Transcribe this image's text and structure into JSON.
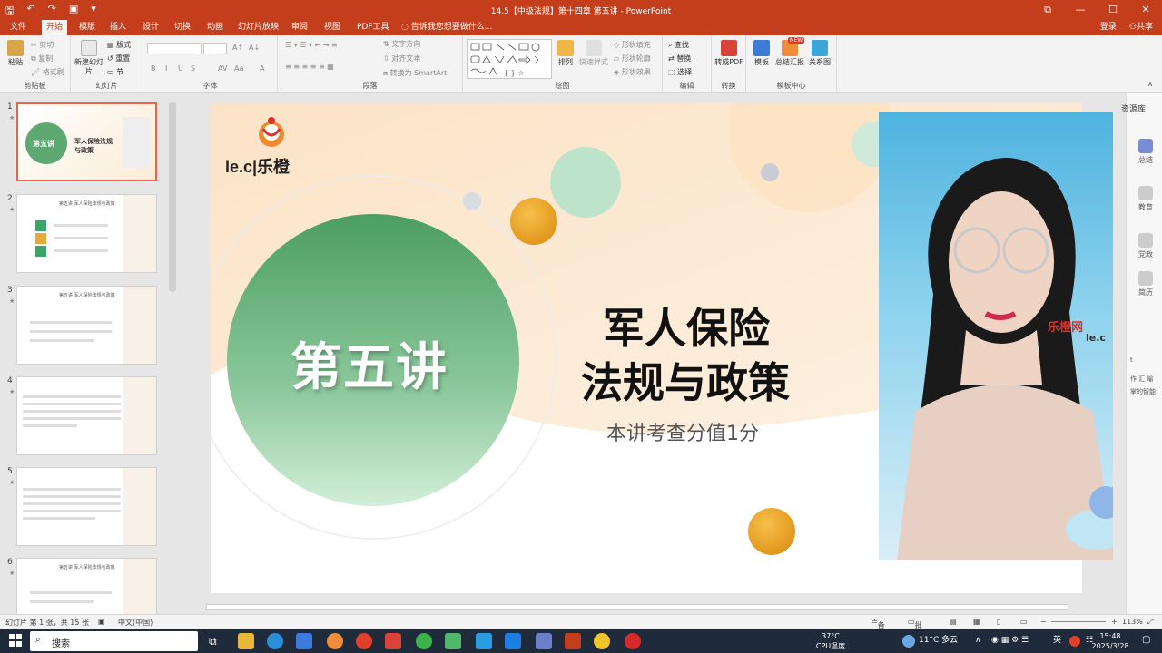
{
  "window": {
    "title": "14.5【中级法规】第十四章 第五讲 - PowerPoint",
    "controls": [
      "⧉",
      "—",
      "☐",
      "✕"
    ]
  },
  "tabs": {
    "items": [
      "文件",
      "开始",
      "模版",
      "插入",
      "设计",
      "切换",
      "动画",
      "幻灯片放映",
      "审阅",
      "视图",
      "PDF工具"
    ],
    "active_index": 1,
    "tell_me": "告诉我您想要做什么...",
    "login": "登录",
    "share": "共享"
  },
  "ribbon": {
    "clipboard": {
      "label": "剪贴板",
      "paste": "粘贴",
      "cut": "剪切",
      "copy": "复制",
      "format_painter": "格式刷"
    },
    "slides": {
      "label": "幻灯片",
      "new_slide": "新建幻灯片",
      "layout": "版式",
      "reset": "重置",
      "section": "节"
    },
    "font": {
      "label": "字体",
      "bold": "B",
      "italic": "I",
      "underline": "U",
      "strike": "S",
      "spacing": "AV",
      "case": "Aa",
      "color": "A"
    },
    "paragraph": {
      "label": "段落",
      "text_direction": "文字方向",
      "align_text": "对齐文本",
      "smartart": "转换为 SmartArt"
    },
    "drawing": {
      "label": "绘图",
      "arrange": "排列",
      "quick_styles": "快速样式",
      "fill": "形状填充",
      "outline": "形状轮廓",
      "effects": "形状效果"
    },
    "editing": {
      "label": "编辑",
      "find": "查找",
      "replace": "替换",
      "select": "选择"
    },
    "convert": {
      "label": "转换",
      "to_pdf": "转成PDF"
    },
    "template_center": {
      "label": "模板中心",
      "template": "模板",
      "summary": "总结汇报",
      "relation": "关系图",
      "new_badge": "NEW"
    }
  },
  "thumbnails": [
    {
      "num": "1",
      "title": "第五讲",
      "subtitle": "军人保险法规与政策"
    },
    {
      "num": "2",
      "title": "第五讲 军人保险法规与政策"
    },
    {
      "num": "3",
      "title": "第五讲 军人保险法规与政策"
    },
    {
      "num": "4",
      "title": ""
    },
    {
      "num": "5",
      "title": ""
    },
    {
      "num": "6",
      "title": "第五讲 军人保险法规与政策"
    }
  ],
  "slide": {
    "logo_text": "le.c|乐橙",
    "lecture": "第五讲",
    "title_line1": "军人保险",
    "title_line2": "法规与政策",
    "subtitle": "本讲考查分值1分",
    "colors": {
      "green_circle": "#5ea872",
      "peach": "#f7d9b4",
      "orange_ball": "#e29a1c"
    }
  },
  "right_pane": {
    "header": "资源库",
    "items": [
      "总结",
      "教育",
      "党政",
      "简历"
    ],
    "side_text": [
      "t",
      "作 汇 喻",
      "掌的智能"
    ]
  },
  "webcam": {
    "backdrop_text": "乐橙网",
    "backdrop_logo": "le.c"
  },
  "status": {
    "slide_info": "幻灯片 第 1 张，共 15 张",
    "language": "中文(中国)",
    "notes": "备注",
    "comments": "批注",
    "zoom": "113%"
  },
  "taskbar": {
    "search": "搜索",
    "cpu_temp": "37°C",
    "cpu_label": "CPU温度",
    "weather": "11°C 多云",
    "ime": "英",
    "time": "15:48",
    "date": "2025/3/28"
  }
}
